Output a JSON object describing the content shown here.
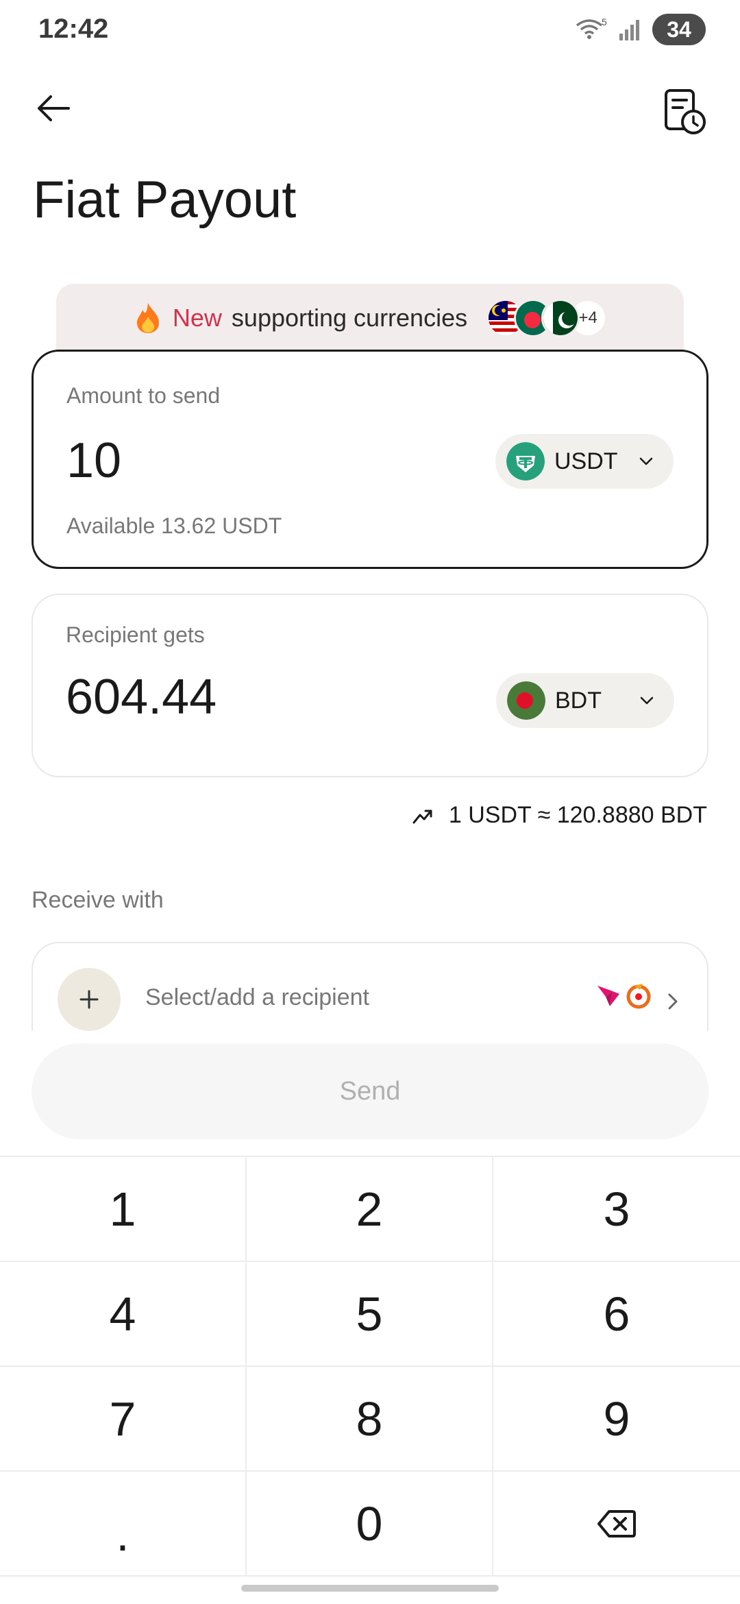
{
  "status_bar": {
    "time": "12:42",
    "battery": "34",
    "wifi_badge": "5"
  },
  "header": {
    "title": "Fiat Payout"
  },
  "banner": {
    "new_label": "New",
    "text": "supporting currencies",
    "extra_count": "+4",
    "flags": [
      "malaysia-flag",
      "bangladesh-flag",
      "pakistan-flag"
    ]
  },
  "amount_card": {
    "label": "Amount to send",
    "value": "10",
    "currency": "USDT",
    "available": "Available 13.62 USDT"
  },
  "recipient_card": {
    "label": "Recipient gets",
    "value": "604.44",
    "currency": "BDT"
  },
  "rate": {
    "text": "1 USDT ≈ 120.8880 BDT"
  },
  "receive": {
    "label": "Receive with",
    "placeholder": "Select/add a recipient"
  },
  "send": {
    "label": "Send"
  },
  "keypad": {
    "keys": [
      "1",
      "2",
      "3",
      "4",
      "5",
      "6",
      "7",
      "8",
      "9",
      ".",
      "0"
    ]
  },
  "colors": {
    "accent_red": "#d0334e",
    "tether_green": "#26a17b",
    "bangladesh_green": "#006a4e",
    "bangladesh_red": "#f42a41"
  }
}
